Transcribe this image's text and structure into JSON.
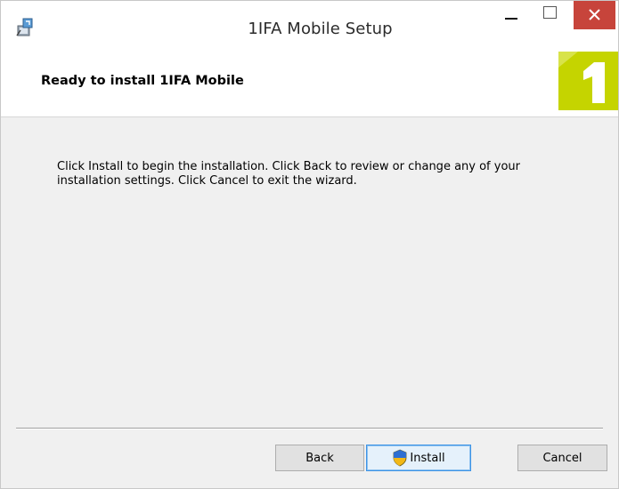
{
  "window": {
    "title": "1IFA Mobile Setup",
    "close_color": "#c7443b"
  },
  "banner": {
    "title": "Ready to install 1IFA Mobile",
    "logo_glyph": "1",
    "logo_color": "#c5d400"
  },
  "content": {
    "message": "Click Install to begin the installation. Click Back to review or change any of your installation settings. Click Cancel to exit the wizard."
  },
  "buttons": {
    "back": "Back",
    "install": "Install",
    "cancel": "Cancel"
  },
  "icons": {
    "app": "installer-icon",
    "minimize": "minimize-icon",
    "maximize": "maximize-icon",
    "close": "close-icon",
    "shield": "uac-shield-icon"
  }
}
